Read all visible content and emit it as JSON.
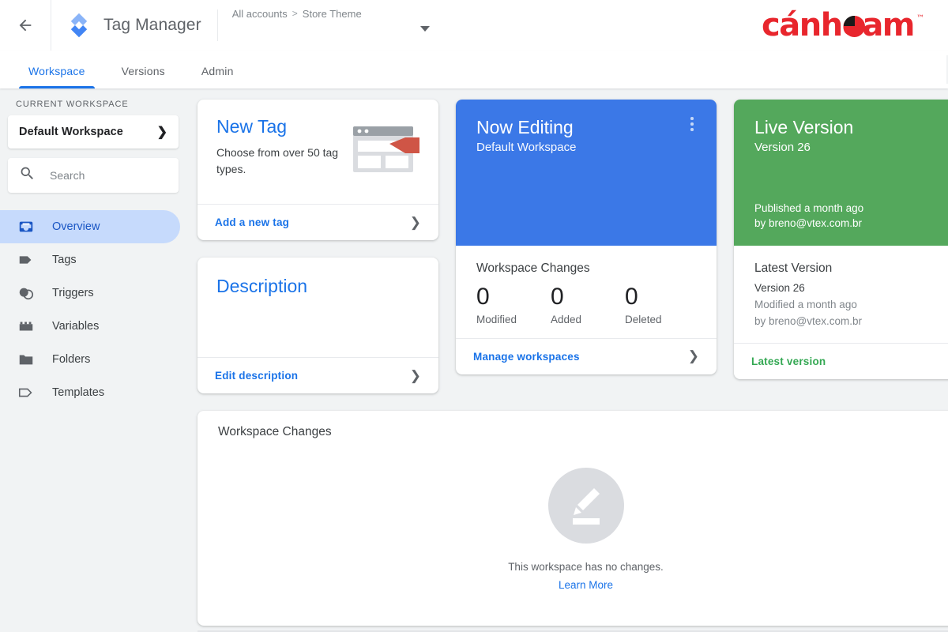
{
  "header": {
    "back_icon": "arrow-left-icon",
    "logo_icon": "tag-manager-logo-icon",
    "title": "Tag Manager",
    "breadcrumb": {
      "account": "All accounts",
      "separator": ">",
      "container": "Store Theme"
    },
    "account_caret_icon": "caret-down-icon",
    "brand_logo": {
      "text": "cánheam",
      "trademark": "™",
      "color": "#e8262d"
    }
  },
  "tabs": [
    {
      "label": "Workspace",
      "active": true
    },
    {
      "label": "Versions",
      "active": false
    },
    {
      "label": "Admin",
      "active": false
    }
  ],
  "sidebar": {
    "section_label": "CURRENT WORKSPACE",
    "workspace_select": {
      "value": "Default Workspace",
      "chevron_icon": "chevron-right-icon"
    },
    "search": {
      "placeholder": "Search",
      "value": "",
      "icon": "search-icon"
    },
    "items": [
      {
        "label": "Overview",
        "icon": "inbox-icon",
        "active": true
      },
      {
        "label": "Tags",
        "icon": "tag-icon",
        "active": false
      },
      {
        "label": "Triggers",
        "icon": "triggers-circles-icon",
        "active": false
      },
      {
        "label": "Variables",
        "icon": "variables-brick-icon",
        "active": false
      },
      {
        "label": "Folders",
        "icon": "folder-icon",
        "active": false
      },
      {
        "label": "Templates",
        "icon": "template-tag-outline-icon",
        "active": false
      }
    ]
  },
  "cards": {
    "new_tag": {
      "title": "New Tag",
      "subtitle": "Choose from over 50 tag types.",
      "illustration_icon": "browser-with-tag-icon",
      "footer_link": "Add a new tag",
      "footer_chevron_icon": "chevron-right-icon"
    },
    "description": {
      "title": "Description",
      "footer_link": "Edit description",
      "footer_chevron_icon": "chevron-right-icon"
    },
    "now_editing": {
      "title": "Now Editing",
      "subtitle": "Default Workspace",
      "menu_icon": "more-vert-icon",
      "accent_color": "#3b78e7",
      "changes_title": "Workspace Changes",
      "counters": [
        {
          "value": "0",
          "label": "Modified"
        },
        {
          "value": "0",
          "label": "Added"
        },
        {
          "value": "0",
          "label": "Deleted"
        }
      ],
      "footer_link": "Manage workspaces",
      "footer_chevron_icon": "chevron-right-icon"
    },
    "live_version": {
      "title": "Live Version",
      "subtitle": "Version 26",
      "published": "Published a month ago",
      "published_by": "by breno@vtex.com.br",
      "accent_color": "#54a85c",
      "latest_title": "Latest Version",
      "latest_version": "Version 26",
      "latest_modified": "Modified a month ago",
      "latest_by": "by breno@vtex.com.br",
      "footer_link": "Latest version"
    }
  },
  "workspace_changes_panel": {
    "title": "Workspace Changes",
    "empty_icon": "pencil-edit-icon",
    "empty_message": "This workspace has no changes.",
    "empty_link": "Learn More"
  }
}
